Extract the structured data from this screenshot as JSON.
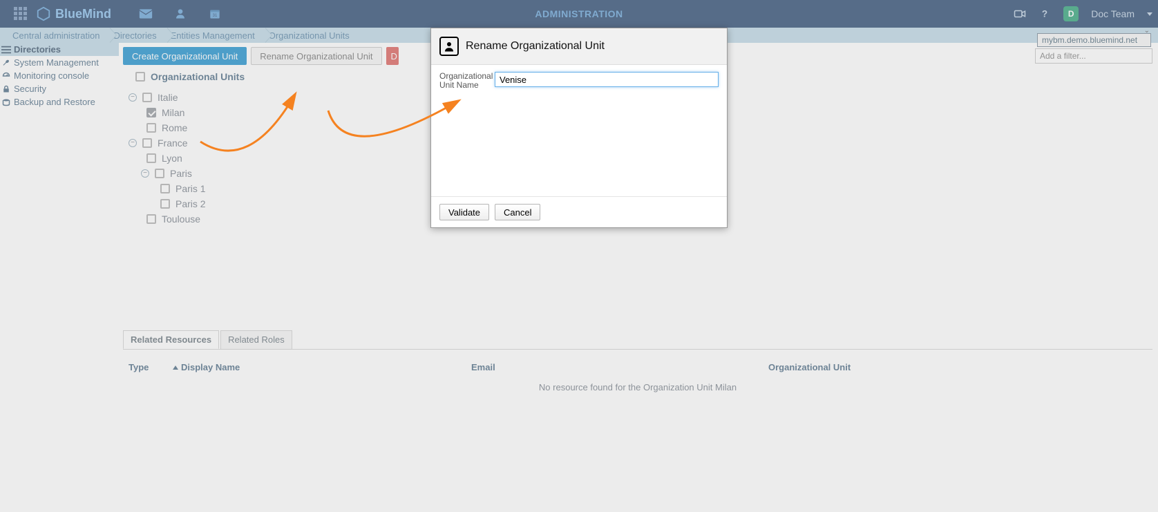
{
  "brand": "BlueMind",
  "page_title": "ADMINISTRATION",
  "user_name": "Doc Team",
  "user_initial": "D",
  "breadcrumbs": [
    "Central administration",
    "Directories",
    "Entities Management",
    "Organizational Units"
  ],
  "domain_selected": "mybm.demo.bluemind.net",
  "sidebar": {
    "items": [
      {
        "label": "Directories",
        "active": true
      },
      {
        "label": "System Management",
        "active": false
      },
      {
        "label": "Monitoring console",
        "active": false
      },
      {
        "label": "Security",
        "active": false
      },
      {
        "label": "Backup and Restore",
        "active": false
      }
    ]
  },
  "toolbar": {
    "create": "Create Organizational Unit",
    "rename": "Rename Organizational Unit",
    "delete_partial": "D"
  },
  "filter_placeholder": "Add a filter...",
  "tree": {
    "header": "Organizational Units",
    "nodes": [
      {
        "level": 1,
        "label": "Italie",
        "expander": "−",
        "checked": false
      },
      {
        "level": 2,
        "label": "Milan",
        "checked": true
      },
      {
        "level": 2,
        "label": "Rome",
        "checked": false
      },
      {
        "level": 1,
        "label": "France",
        "expander": "−",
        "checked": false
      },
      {
        "level": 2,
        "label": "Lyon",
        "checked": false
      },
      {
        "level": 3,
        "label": "Paris",
        "expander": "−",
        "checked": false
      },
      {
        "level": 4,
        "label": "Paris 1",
        "checked": false
      },
      {
        "level": 4,
        "label": "Paris 2",
        "checked": false
      },
      {
        "level": 2,
        "label": "Toulouse",
        "checked": false
      }
    ]
  },
  "tabs": {
    "related_resources": "Related Resources",
    "related_roles": "Related Roles"
  },
  "table": {
    "col_type": "Type",
    "col_display_name": "Display Name",
    "col_email": "Email",
    "col_org_unit": "Organizational Unit",
    "empty_msg": "No resource found for the Organization Unit Milan"
  },
  "dialog": {
    "title": "Rename Organizational Unit",
    "field_label": "Organizational Unit Name",
    "field_value": "Venise",
    "validate": "Validate",
    "cancel": "Cancel"
  }
}
